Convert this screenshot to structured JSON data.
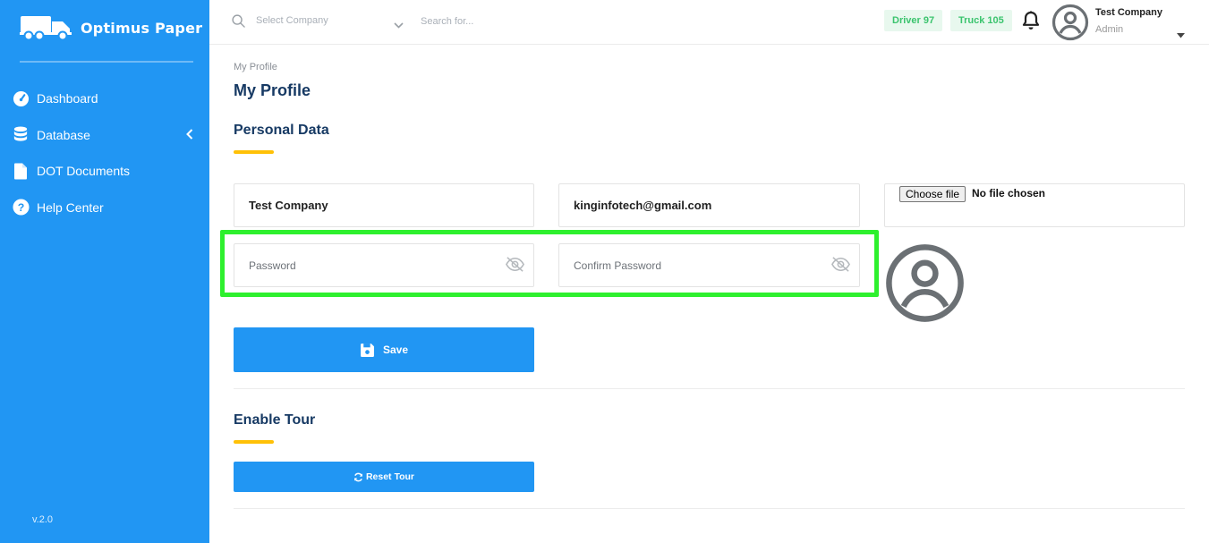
{
  "app": {
    "name": "Optimus Paper",
    "version": "v.2.0"
  },
  "sidebar": {
    "items": [
      {
        "label": "Dashboard",
        "icon": "gauge-icon"
      },
      {
        "label": "Database",
        "icon": "database-icon"
      },
      {
        "label": "DOT Documents",
        "icon": "document-icon"
      },
      {
        "label": "Help Center",
        "icon": "help-icon"
      }
    ]
  },
  "topbar": {
    "company_placeholder": "Select Company",
    "search_placeholder": "Search for...",
    "driver_badge": "Driver 97",
    "truck_badge": "Truck 105",
    "user_name": "Test Company",
    "user_role": "Admin"
  },
  "page": {
    "breadcrumb": "My Profile",
    "title": "My Profile"
  },
  "personal": {
    "title": "Personal Data",
    "company_name": "Test Company",
    "email": "kinginfotech@gmail.com",
    "password_placeholder": "Password",
    "confirm_password_placeholder": "Confirm Password",
    "file_button": "Choose file",
    "file_status": "No file chosen",
    "save_label": "Save"
  },
  "tour": {
    "title": "Enable Tour",
    "reset_label": "Reset Tour"
  },
  "colors": {
    "sidebar": "#2196f3",
    "primary": "#2196f3",
    "title": "#173a64",
    "accent_bar": "#ffc107",
    "badge_bg": "#e8f8ee",
    "badge_text": "#3bc46e",
    "highlight": "#2ef02e"
  }
}
